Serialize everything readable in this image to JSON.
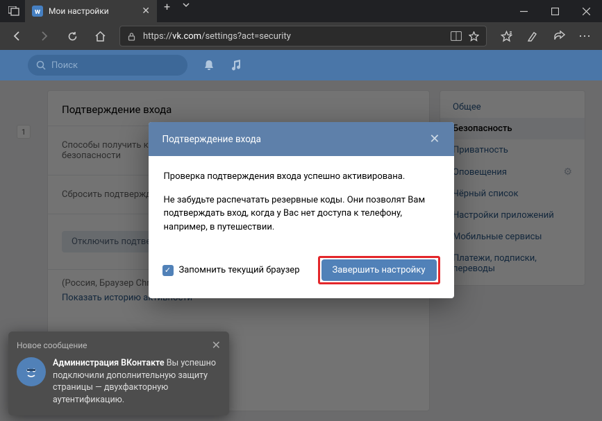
{
  "browser": {
    "tab": {
      "favicon_letter": "w",
      "title": "Мои настройки"
    },
    "url_prefix": "https://",
    "url_domain": "vk.com",
    "url_path": "/settings?act=security"
  },
  "vk_header": {
    "search_placeholder": "Поиск"
  },
  "sidebar": {
    "items": [
      {
        "label": "Общее"
      },
      {
        "label": "Безопасность",
        "active": true
      },
      {
        "label": "Приватность"
      },
      {
        "label": "Оповещения",
        "gear": true
      },
      {
        "label": "Чёрный список"
      },
      {
        "label": "Настройки приложений"
      },
      {
        "label": "Мобильные сервисы"
      },
      {
        "label": "Платежи, подписки, переводы"
      }
    ]
  },
  "left_rail": {
    "badge": "1"
  },
  "panel": {
    "heading": "Подтверждение входа",
    "row1_label": "Способы получить код безопасности",
    "row2_label": "Сбросить подтверждение",
    "disable_button": "Отключить подтверждение входа",
    "session_info": "(Россия, Браузер Chrome)",
    "history_link": "Показать историю активности"
  },
  "modal": {
    "title": "Подтверждение входа",
    "msg1": "Проверка подтверждения входа успешно активирована.",
    "msg2": "Не забудьте распечатать резервные коды. Они позволят Вам подтверждать вход, когда у Вас нет доступа к телефону, например, в путешествии.",
    "remember": "Запомнить текущий браузер",
    "cta": "Завершить настройку"
  },
  "toast": {
    "header": "Новое сообщение",
    "sender": "Администрация ВКонтакте",
    "body_prefix": " Вы успешно подключили дополнительную защиту страницы — двухфакторную аутентификацию."
  }
}
